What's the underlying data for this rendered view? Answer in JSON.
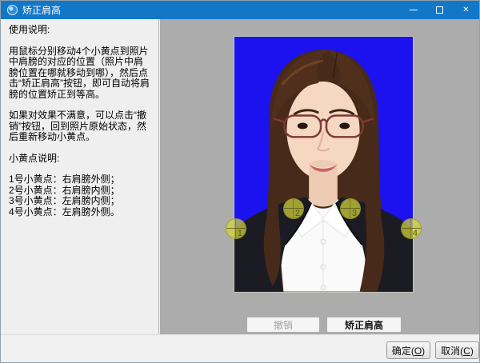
{
  "window": {
    "title": "矫正肩高",
    "close_glyph": "✕"
  },
  "colors": {
    "titlebar_blue": "#1377C7",
    "photo_background": "#1B12EF",
    "dot_yellow": "#D6D63C",
    "backdrop_gray": "#ACACAC"
  },
  "instructions": {
    "usage_title": "使用说明:",
    "usage_p1": "用鼠标分别移动4个小黄点到照片中肩膀的对应的位置（照片中肩膀位置在哪就移动到哪），然后点击“矫正肩高”按钮，即可自动将肩膀的位置矫正到等高。",
    "usage_p2": "如果对效果不满意，可以点击“撤销”按钮，回到照片原始状态，然后重新移动小黄点。",
    "dots_title": "小黄点说明:",
    "dot_lines": [
      "1号小黄点：右肩膀外侧；",
      "2号小黄点：右肩膀内侧；",
      "3号小黄点：左肩膀内侧；",
      "4号小黄点：左肩膀外侧。"
    ]
  },
  "photo": {
    "dots": [
      {
        "label": "1"
      },
      {
        "label": "2"
      },
      {
        "label": "3"
      },
      {
        "label": "4"
      }
    ]
  },
  "actions": {
    "undo": "撤销",
    "correct": "矫正肩高"
  },
  "footer": {
    "ok_prefix": "确定(",
    "ok_mnemonic": "O",
    "ok_suffix": ")",
    "cancel_prefix": "取消(",
    "cancel_mnemonic": "C",
    "cancel_suffix": ")"
  }
}
